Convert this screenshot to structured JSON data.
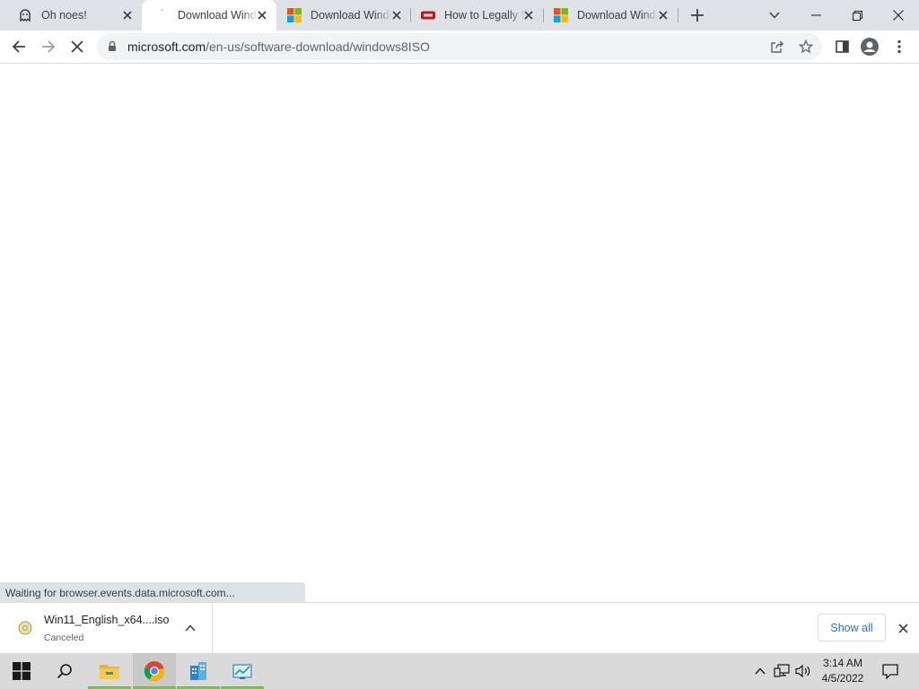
{
  "tabs": [
    {
      "title": "Oh noes!",
      "favicon": "ghost-icon",
      "active": false
    },
    {
      "title": "Download Windows",
      "favicon": "loading-throbber-icon",
      "active": true
    },
    {
      "title": "Download Windows",
      "favicon": "microsoft-logo-icon",
      "active": false
    },
    {
      "title": "How to Legally Download",
      "favicon": "red-site-logo-icon",
      "active": false
    },
    {
      "title": "Download Windows",
      "favicon": "microsoft-logo-icon",
      "active": false
    }
  ],
  "address_bar": {
    "domain": "microsoft.com",
    "path": "/en-us/software-download/windows8ISO"
  },
  "status_bubble": "Waiting for browser.events.data.microsoft.com...",
  "download_shelf": {
    "item_name": "Win11_English_x64....iso",
    "item_status": "Canceled",
    "show_all_label": "Show all"
  },
  "taskbar": {
    "time": "3:14 AM",
    "date": "4/5/2022"
  },
  "colors": {
    "tabstrip": "#dee1e6",
    "accent": "#1a73e8",
    "taskbar": "#dadada",
    "running_indicator": "#7fbf3f"
  }
}
